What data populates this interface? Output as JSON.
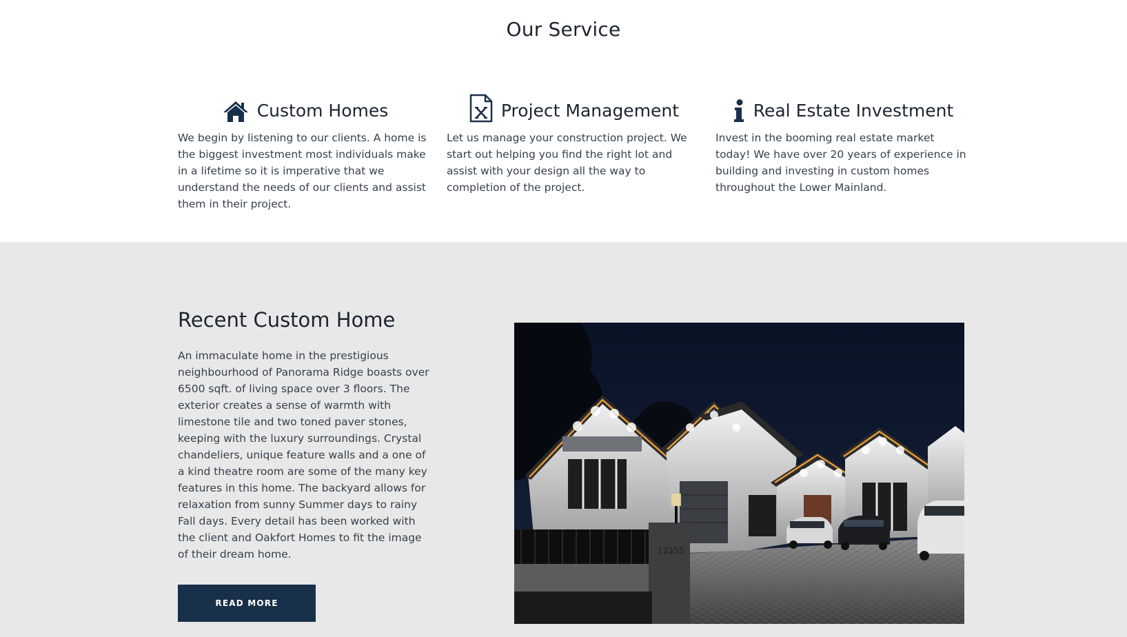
{
  "services": {
    "title": "Our Service",
    "items": [
      {
        "icon": "home-icon",
        "title": "Custom Homes",
        "text": "We begin by listening to our clients. A home is the biggest investment most individuals make in a lifetime so it is imperative that we understand the needs of our clients and assist them in their project."
      },
      {
        "icon": "document-x-icon",
        "title": "Project Management",
        "text": "Let us manage your construction project. We start out helping you find the right lot and assist with your design all the way to completion of the project."
      },
      {
        "icon": "info-icon",
        "title": "Real Estate Investment",
        "text": "Invest in the booming real estate market today! We have over 20 years of experience in building and investing in custom homes throughout the Lower Mainland."
      }
    ]
  },
  "recent": {
    "title": "Recent Custom Home",
    "text": "An immaculate home in the prestigious neighbourhood of Panorama Ridge boasts over 6500 sqft. of living space over 3 floors. The exterior creates a sense of warmth with limestone tile and two toned paver stones, keeping with the luxury surroundings. Crystal chandeliers, unique feature walls and a one of a kind theatre room are some of the many key features in this home. The backyard allows for relaxation from sunny Summer days to rainy Fall days. Every detail has been worked with the client and Oakfort Homes to fit the image of their dream home.",
    "button_label": "READ MORE",
    "address_number": "12355"
  },
  "colors": {
    "heading": "#1c2430",
    "body_text": "#35404c",
    "icon": "#19304a",
    "button_bg": "#19304a",
    "section_bg": "#e8e8e8"
  }
}
